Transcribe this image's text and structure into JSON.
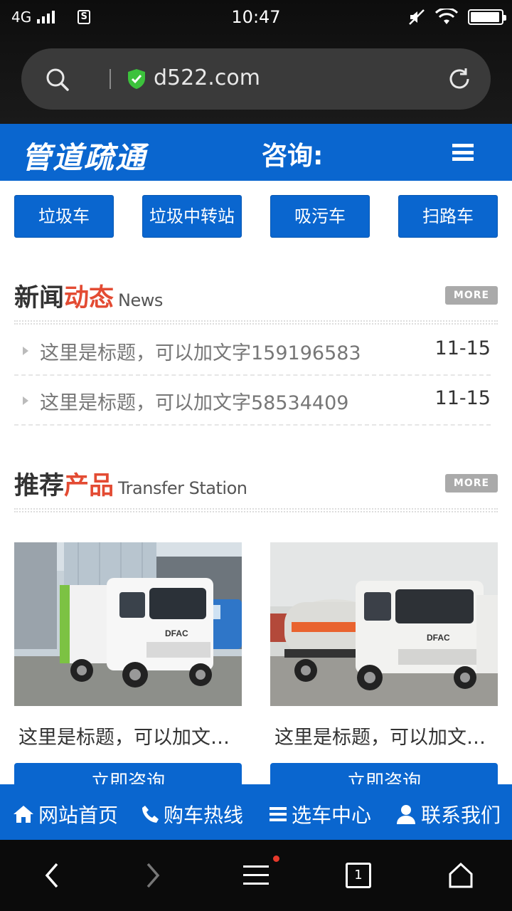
{
  "status_bar": {
    "network": "4G",
    "sim_label": "S",
    "time": "10:47"
  },
  "browser": {
    "url": "d522.com",
    "battery_level": 0.95
  },
  "site_header": {
    "logo": "管道疏通",
    "consult_label": "咨询:"
  },
  "categories": [
    "垃圾车",
    "垃圾中转站",
    "吸污车",
    "扫路车"
  ],
  "news": {
    "title_dark": "新闻",
    "title_red": "动态",
    "title_en": "News",
    "more_label": "MORE",
    "items": [
      {
        "title": "这里是标题，可以加文字159196583",
        "date": "11-15"
      },
      {
        "title": "这里是标题，可以加文字58534409",
        "date": "11-15"
      }
    ]
  },
  "products": {
    "title_dark": "推荐",
    "title_red": "产品",
    "title_en": "Transfer Station",
    "more_label": "MORE",
    "items": [
      {
        "title": "这里是标题，可以加文…",
        "button": "立即咨询",
        "brand": "DFAC"
      },
      {
        "title": "这里是标题，可以加文…",
        "button": "立即咨询",
        "brand": "DFAC"
      }
    ]
  },
  "bottom_nav": [
    "网站首页",
    "购车热线",
    "选车中心",
    "联系我们"
  ],
  "system_nav": {
    "tab_count": "1"
  },
  "colors": {
    "brand_blue": "#0a66cf",
    "accent_red": "#e34b33"
  }
}
